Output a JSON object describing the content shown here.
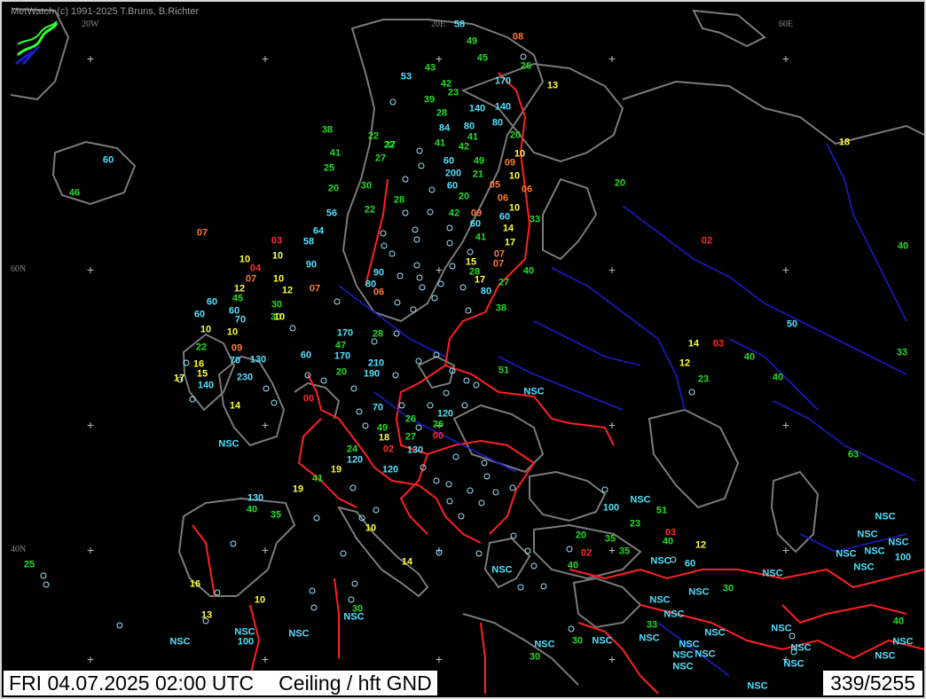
{
  "credit": "MetWatch  (c) 1991-2025 T.Bruns, B.Richter",
  "status": {
    "datetime": "FRI 04.07.2025 02:00 UTC",
    "parameter": "Ceiling / hft GND",
    "count": "339/5255"
  },
  "grid_labels": [
    "20W",
    "20E",
    "60E",
    "60N",
    "40N"
  ],
  "colors": {
    "background": "#000000",
    "coastline": "#7a7a7a",
    "borders": "#ff2020",
    "rivers": "#1c1cc8",
    "cyan": "#4ee2ff",
    "green": "#22dd22",
    "yellow": "#ffff33",
    "orange": "#ff7a33",
    "red": "#ff2a2a",
    "station_marker": "#9be3ff"
  },
  "observations": [
    {
      "v": "58",
      "c": "cyan"
    },
    {
      "v": "49",
      "c": "green"
    },
    {
      "v": "08",
      "c": "orange"
    },
    {
      "v": "45",
      "c": "green"
    },
    {
      "v": "26",
      "c": "green"
    },
    {
      "v": "43",
      "c": "green"
    },
    {
      "v": "53",
      "c": "cyan"
    },
    {
      "v": "170",
      "c": "cyan"
    },
    {
      "v": "13",
      "c": "yellow"
    },
    {
      "v": "42",
      "c": "green"
    },
    {
      "v": "23",
      "c": "green"
    },
    {
      "v": "39",
      "c": "green"
    },
    {
      "v": "140",
      "c": "cyan"
    },
    {
      "v": "140",
      "c": "cyan"
    },
    {
      "v": "28",
      "c": "green"
    },
    {
      "v": "80",
      "c": "cyan"
    },
    {
      "v": "84",
      "c": "cyan"
    },
    {
      "v": "80",
      "c": "cyan"
    },
    {
      "v": "38",
      "c": "green"
    },
    {
      "v": "22",
      "c": "green"
    },
    {
      "v": "41",
      "c": "green"
    },
    {
      "v": "20",
      "c": "green"
    },
    {
      "v": "41",
      "c": "green"
    },
    {
      "v": "42",
      "c": "green"
    },
    {
      "v": "22",
      "c": "green"
    },
    {
      "v": "37",
      "c": "green"
    },
    {
      "v": "18",
      "c": "yellow"
    },
    {
      "v": "41",
      "c": "green"
    },
    {
      "v": "60",
      "c": "cyan"
    },
    {
      "v": "10",
      "c": "yellow"
    },
    {
      "v": "27",
      "c": "green"
    },
    {
      "v": "49",
      "c": "green"
    },
    {
      "v": "09",
      "c": "orange"
    },
    {
      "v": "25",
      "c": "green"
    },
    {
      "v": "200",
      "c": "cyan"
    },
    {
      "v": "21",
      "c": "green"
    },
    {
      "v": "10",
      "c": "yellow"
    },
    {
      "v": "20",
      "c": "green"
    },
    {
      "v": "30",
      "c": "green"
    },
    {
      "v": "60",
      "c": "cyan"
    },
    {
      "v": "05",
      "c": "orange"
    },
    {
      "v": "06",
      "c": "orange"
    },
    {
      "v": "20",
      "c": "green"
    },
    {
      "v": "28",
      "c": "green"
    },
    {
      "v": "20",
      "c": "green"
    },
    {
      "v": "06",
      "c": "orange"
    },
    {
      "v": "60",
      "c": "cyan"
    },
    {
      "v": "46",
      "c": "green"
    },
    {
      "v": "56",
      "c": "cyan"
    },
    {
      "v": "22",
      "c": "green"
    },
    {
      "v": "42",
      "c": "green"
    },
    {
      "v": "09",
      "c": "orange"
    },
    {
      "v": "10",
      "c": "yellow"
    },
    {
      "v": "60",
      "c": "cyan"
    },
    {
      "v": "33",
      "c": "green"
    },
    {
      "v": "64",
      "c": "cyan"
    },
    {
      "v": "60",
      "c": "cyan"
    },
    {
      "v": "14",
      "c": "yellow"
    },
    {
      "v": "07",
      "c": "orange"
    },
    {
      "v": "03",
      "c": "red"
    },
    {
      "v": "58",
      "c": "cyan"
    },
    {
      "v": "41",
      "c": "green"
    },
    {
      "v": "17",
      "c": "yellow"
    },
    {
      "v": "02",
      "c": "red"
    },
    {
      "v": "40",
      "c": "green"
    },
    {
      "v": "10",
      "c": "yellow"
    },
    {
      "v": "10",
      "c": "yellow"
    },
    {
      "v": "90",
      "c": "cyan"
    },
    {
      "v": "15",
      "c": "yellow"
    },
    {
      "v": "07",
      "c": "orange"
    },
    {
      "v": "04",
      "c": "red"
    },
    {
      "v": "07",
      "c": "orange"
    },
    {
      "v": "90",
      "c": "cyan"
    },
    {
      "v": "28",
      "c": "green"
    },
    {
      "v": "07",
      "c": "orange"
    },
    {
      "v": "40",
      "c": "green"
    },
    {
      "v": "07",
      "c": "orange"
    },
    {
      "v": "10",
      "c": "yellow"
    },
    {
      "v": "80",
      "c": "cyan"
    },
    {
      "v": "17",
      "c": "yellow"
    },
    {
      "v": "27",
      "c": "green"
    },
    {
      "v": "12",
      "c": "yellow"
    },
    {
      "v": "12",
      "c": "yellow"
    },
    {
      "v": "06",
      "c": "orange"
    },
    {
      "v": "80",
      "c": "cyan"
    },
    {
      "v": "30",
      "c": "green"
    },
    {
      "v": "60",
      "c": "cyan"
    },
    {
      "v": "45",
      "c": "green"
    },
    {
      "v": "30",
      "c": "green"
    },
    {
      "v": "38",
      "c": "green"
    },
    {
      "v": "60",
      "c": "cyan"
    },
    {
      "v": "60",
      "c": "cyan"
    },
    {
      "v": "70",
      "c": "cyan"
    },
    {
      "v": "10",
      "c": "yellow"
    },
    {
      "v": "50",
      "c": "cyan"
    },
    {
      "v": "10",
      "c": "yellow"
    },
    {
      "v": "10",
      "c": "yellow"
    },
    {
      "v": "170",
      "c": "cyan"
    },
    {
      "v": "28",
      "c": "green"
    },
    {
      "v": "14",
      "c": "yellow"
    },
    {
      "v": "03",
      "c": "red"
    },
    {
      "v": "22",
      "c": "green"
    },
    {
      "v": "09",
      "c": "orange"
    },
    {
      "v": "47",
      "c": "green"
    },
    {
      "v": "60",
      "c": "cyan"
    },
    {
      "v": "170",
      "c": "cyan"
    },
    {
      "v": "40",
      "c": "green"
    },
    {
      "v": "33",
      "c": "green"
    },
    {
      "v": "16",
      "c": "yellow"
    },
    {
      "v": "70",
      "c": "cyan"
    },
    {
      "v": "130",
      "c": "cyan"
    },
    {
      "v": "210",
      "c": "cyan"
    },
    {
      "v": "12",
      "c": "yellow"
    },
    {
      "v": "17",
      "c": "yellow"
    },
    {
      "v": "15",
      "c": "yellow"
    },
    {
      "v": "20",
      "c": "green"
    },
    {
      "v": "190",
      "c": "cyan"
    },
    {
      "v": "51",
      "c": "green"
    },
    {
      "v": "40",
      "c": "green"
    },
    {
      "v": "23",
      "c": "green"
    },
    {
      "v": "140",
      "c": "cyan"
    },
    {
      "v": "230",
      "c": "cyan"
    },
    {
      "v": "NSC",
      "c": "cyan"
    },
    {
      "v": "00",
      "c": "red"
    },
    {
      "v": "14",
      "c": "yellow"
    },
    {
      "v": "70",
      "c": "cyan"
    },
    {
      "v": "120",
      "c": "cyan"
    },
    {
      "v": "26",
      "c": "green"
    },
    {
      "v": "26",
      "c": "green"
    },
    {
      "v": "NSC",
      "c": "cyan"
    },
    {
      "v": "49",
      "c": "green"
    },
    {
      "v": "18",
      "c": "yellow"
    },
    {
      "v": "27",
      "c": "green"
    },
    {
      "v": "00",
      "c": "red"
    },
    {
      "v": "24",
      "c": "green"
    },
    {
      "v": "02",
      "c": "red"
    },
    {
      "v": "130",
      "c": "cyan"
    },
    {
      "v": "63",
      "c": "green"
    },
    {
      "v": "120",
      "c": "cyan"
    },
    {
      "v": "19",
      "c": "yellow"
    },
    {
      "v": "120",
      "c": "cyan"
    },
    {
      "v": "41",
      "c": "green"
    },
    {
      "v": "19",
      "c": "yellow"
    },
    {
      "v": "130",
      "c": "cyan"
    },
    {
      "v": "NSC",
      "c": "cyan"
    },
    {
      "v": "100",
      "c": "cyan"
    },
    {
      "v": "51",
      "c": "green"
    },
    {
      "v": "40",
      "c": "green"
    },
    {
      "v": "35",
      "c": "green"
    },
    {
      "v": "23",
      "c": "green"
    },
    {
      "v": "NSC",
      "c": "cyan"
    },
    {
      "v": "10",
      "c": "yellow"
    },
    {
      "v": "20",
      "c": "green"
    },
    {
      "v": "35",
      "c": "green"
    },
    {
      "v": "03",
      "c": "red"
    },
    {
      "v": "40",
      "c": "green"
    },
    {
      "v": "12",
      "c": "yellow"
    },
    {
      "v": "NSC",
      "c": "cyan"
    },
    {
      "v": "NSC",
      "c": "cyan"
    },
    {
      "v": "NSC",
      "c": "cyan"
    },
    {
      "v": "02",
      "c": "red"
    },
    {
      "v": "35",
      "c": "green"
    },
    {
      "v": "NSC",
      "c": "cyan"
    },
    {
      "v": "25",
      "c": "green"
    },
    {
      "v": "14",
      "c": "yellow"
    },
    {
      "v": "NSC",
      "c": "cyan"
    },
    {
      "v": "40",
      "c": "green"
    },
    {
      "v": "60",
      "c": "cyan"
    },
    {
      "v": "NSC",
      "c": "cyan"
    },
    {
      "v": "16",
      "c": "yellow"
    },
    {
      "v": "10",
      "c": "yellow"
    },
    {
      "v": "30",
      "c": "green"
    },
    {
      "v": "NSC",
      "c": "cyan"
    },
    {
      "v": "30",
      "c": "green"
    },
    {
      "v": "NSC",
      "c": "cyan"
    },
    {
      "v": "13",
      "c": "yellow"
    },
    {
      "v": "NSC",
      "c": "cyan"
    },
    {
      "v": "NSC",
      "c": "cyan"
    },
    {
      "v": "100",
      "c": "cyan"
    },
    {
      "v": "NSC",
      "c": "cyan"
    },
    {
      "v": "NSC",
      "c": "cyan"
    },
    {
      "v": "NSC",
      "c": "cyan"
    },
    {
      "v": "NSC",
      "c": "cyan"
    },
    {
      "v": "40",
      "c": "green"
    },
    {
      "v": "33",
      "c": "green"
    },
    {
      "v": "NSC",
      "c": "cyan"
    },
    {
      "v": "NSC",
      "c": "cyan"
    },
    {
      "v": "NSC",
      "c": "cyan"
    },
    {
      "v": "NSC",
      "c": "cyan"
    },
    {
      "v": "100",
      "c": "cyan"
    },
    {
      "v": "30",
      "c": "green"
    },
    {
      "v": "NSC",
      "c": "cyan"
    },
    {
      "v": "NSC",
      "c": "cyan"
    },
    {
      "v": "NSC",
      "c": "cyan"
    },
    {
      "v": "NSC",
      "c": "cyan"
    },
    {
      "v": "NSC",
      "c": "cyan"
    },
    {
      "v": "NSC",
      "c": "cyan"
    },
    {
      "v": "NSC",
      "c": "cyan"
    },
    {
      "v": "NSC",
      "c": "cyan"
    },
    {
      "v": "NSC",
      "c": "cyan"
    },
    {
      "v": "30",
      "c": "green"
    },
    {
      "v": "NSC",
      "c": "cyan"
    },
    {
      "v": "NSC",
      "c": "cyan"
    }
  ]
}
